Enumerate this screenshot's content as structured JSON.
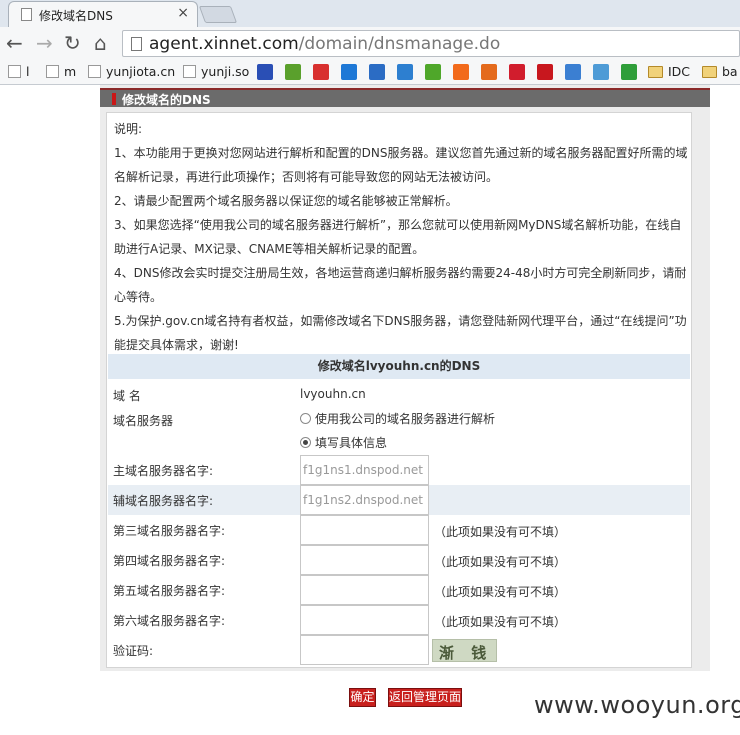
{
  "browser": {
    "tab_title": "修改域名DNS",
    "tab_close": "×",
    "url_host": "agent.xinnet.com",
    "url_path": "/domain/dnsmanage.do",
    "nav": {
      "back": "←",
      "forward": "→",
      "reload": "↻",
      "home": "⌂"
    },
    "bookmarks": [
      {
        "label": "l",
        "icon": "page-icon"
      },
      {
        "label": "m",
        "icon": "page-icon"
      },
      {
        "label": "yunjiota.cn",
        "icon": "page-icon"
      },
      {
        "label": "yunji.so",
        "icon": "page-icon"
      },
      {
        "label": "",
        "icon": "paw-icon",
        "color": "#2a4fb5"
      },
      {
        "label": "",
        "icon": "m-icon",
        "color": "#5aa02c"
      },
      {
        "label": "",
        "icon": "weibo-icon",
        "color": "#d8302f"
      },
      {
        "label": "",
        "icon": "zhi-icon",
        "color": "#1e78d6"
      },
      {
        "label": "",
        "icon": "g-icon",
        "color": "#2b6cc4"
      },
      {
        "label": "",
        "icon": "play-icon",
        "color": "#2d7fd0"
      },
      {
        "label": "",
        "icon": "iqiyi-icon",
        "color": "#4fa72a"
      },
      {
        "label": "",
        "icon": "taobao-icon",
        "color": "#f26a1b"
      },
      {
        "label": "",
        "icon": "fox-icon",
        "color": "#e46a1c"
      },
      {
        "label": "",
        "icon": "circle-icon",
        "color": "#d11d2d"
      },
      {
        "label": "",
        "icon": "t-icon",
        "color": "#c8171e"
      },
      {
        "label": "",
        "icon": "translate-icon",
        "color": "#3b7fd2"
      },
      {
        "label": "",
        "icon": "note-icon",
        "color": "#4e9bd6"
      },
      {
        "label": "",
        "icon": "tree-icon",
        "color": "#2f9e3a"
      },
      {
        "label": "IDC",
        "icon": "folder-icon"
      },
      {
        "label": "ba",
        "icon": "folder-icon"
      }
    ]
  },
  "panel": {
    "title": "修改域名的DNS",
    "notes": [
      "说明:",
      "1、本功能用于更换对您网站进行解析和配置的DNS服务器。建议您首先通过新的域名服务器配置好所需的域名解析记录，再进行此项操作；否则将有可能导致您的网站无法被访问。",
      "2、请最少配置两个域名服务器以保证您的域名能够被正常解析。",
      "3、如果您选择“使用我公司的域名服务器进行解析”，那么您就可以使用新网MyDNS域名解析功能，在线自助进行A记录、MX记录、CNAME等相关解析记录的配置。",
      "4、DNS修改会实时提交注册局生效，各地运营商递归解析服务器约需要24-48小时方可完全刷新同步，请耐心等待。",
      "5.为保护.gov.cn域名持有者权益，如需修改域名下DNS服务器，请您登陆新网代理平台，通过“在线提问”功能提交具体需求，谢谢!"
    ],
    "sub_title": "修改域名lvyouhn.cn的DNS",
    "domain_label": "域 名",
    "domain_value": "lvyouhn.cn",
    "dns_server_label": "域名服务器",
    "radio_options": [
      {
        "label": "使用我公司的域名服务器进行解析",
        "checked": false
      },
      {
        "label": "填写具体信息",
        "checked": true
      }
    ],
    "fields": [
      {
        "label": "主域名服务器名字:",
        "value": "f1g1ns1.dnspod.net",
        "hint": ""
      },
      {
        "label": "辅域名服务器名字:",
        "value": "f1g1ns2.dnspod.net",
        "hint": ""
      },
      {
        "label": "第三域名服务器名字:",
        "value": "",
        "hint": "（此项如果没有可不填）"
      },
      {
        "label": "第四域名服务器名字:",
        "value": "",
        "hint": "（此项如果没有可不填）"
      },
      {
        "label": "第五域名服务器名字:",
        "value": "",
        "hint": "（此项如果没有可不填）"
      },
      {
        "label": "第六域名服务器名字:",
        "value": "",
        "hint": "（此项如果没有可不填）"
      }
    ],
    "captcha_label": "验证码:",
    "captcha_value": "",
    "captcha_image_text": "渐 钱",
    "confirm_button": "确定",
    "back_button": "返回管理页面"
  },
  "watermark": "www.wooyun.org"
}
